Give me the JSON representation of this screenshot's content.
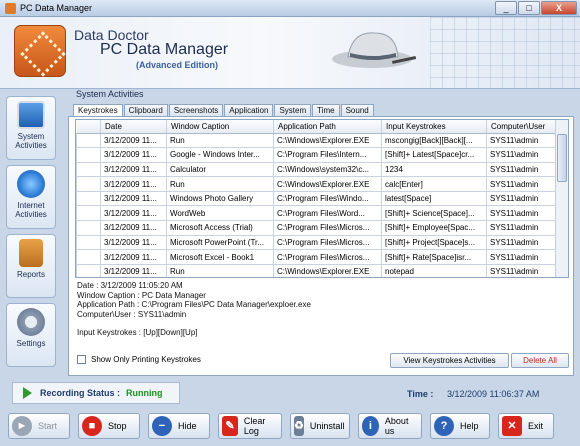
{
  "window": {
    "title": "PC Data Manager",
    "controls": [
      "_",
      "□",
      "X"
    ]
  },
  "header": {
    "line1": "Data Doctor",
    "line2": "PC Data Manager",
    "line3": "(Advanced Edition)"
  },
  "sidebar": {
    "items": [
      {
        "label": "System Activities",
        "icon": "monitor-icon"
      },
      {
        "label": "Internet Activities",
        "icon": "internet-explorer-icon"
      },
      {
        "label": "Reports",
        "icon": "clipboard-icon"
      },
      {
        "label": "Settings",
        "icon": "gear-icon"
      }
    ]
  },
  "main": {
    "section_title": "System Activities",
    "tabs": [
      "Keystrokes",
      "Clipboard",
      "Screenshots",
      "Application",
      "System",
      "Time",
      "Sound"
    ],
    "active_tab": "Keystrokes",
    "table": {
      "columns": [
        "Date",
        "Window Caption",
        "Application Path",
        "Input Keystrokes",
        "Computer\\User"
      ],
      "rows": [
        [
          "3/12/2009 11...",
          "Run",
          "C:\\Windows\\Explorer.EXE",
          "mscongig[Back][Back][...",
          "SYS11\\admin"
        ],
        [
          "3/12/2009 11...",
          "Google - Windows Inter...",
          "C:\\Program Files\\Intern...",
          "[Shift]+ Latest[Space]cr...",
          "SYS11\\admin"
        ],
        [
          "3/12/2009 11...",
          "Calculator",
          "C:\\Windows\\system32\\c...",
          "1234",
          "SYS11\\admin"
        ],
        [
          "3/12/2009 11...",
          "Run",
          "C:\\Windows\\Explorer.EXE",
          "calc[Enter]",
          "SYS11\\admin"
        ],
        [
          "3/12/2009 11...",
          "Windows Photo Gallery",
          "C:\\Program Files\\Windo...",
          "latest[Space]",
          "SYS11\\admin"
        ],
        [
          "3/12/2009 11...",
          "WordWeb",
          "C:\\Program Files\\Word...",
          "[Shift]+ Science[Space]...",
          "SYS11\\admin"
        ],
        [
          "3/12/2009 11...",
          "Microsoft Access (Trial)",
          "C:\\Program Files\\Micros...",
          "[Shift]+ Employee[Spac...",
          "SYS11\\admin"
        ],
        [
          "3/12/2009 11...",
          "Microsoft PowerPoint (Tr...",
          "C:\\Program Files\\Micros...",
          "[Shift]+ Project[Space]s...",
          "SYS11\\admin"
        ],
        [
          "3/12/2009 11...",
          "Microsoft Excel - Book1",
          "C:\\Program Files\\Micros...",
          "[Shift]+ Rate[Space]isr...",
          "SYS11\\admin"
        ],
        [
          "3/12/2009 11...",
          "Run",
          "C:\\Windows\\Explorer.EXE",
          "notepad",
          "SYS11\\admin"
        ]
      ]
    },
    "detail": {
      "date": "Date : 3/12/2009 11:05:20 AM",
      "caption": "Window Caption : PC Data Manager",
      "path": "Application Path : C:\\Program Files\\PC Data Manager\\exploer.exe",
      "user": "Computer\\User : SYS11\\admin",
      "keys": "Input Keystrokes : [Up][Down][Up]"
    },
    "filter_label": "Show Only Printing Keystrokes",
    "view_button": "View Keystrokes Activities",
    "delete_button": "Delete All"
  },
  "status": {
    "recording_label": "Recording Status :",
    "recording_value": "Running",
    "time_label": "Time :",
    "time_value": "3/12/2009 11:06:37 AM"
  },
  "toolbar": {
    "buttons": [
      {
        "label": "Start",
        "icon": "play-icon",
        "color": "#9aa6b5"
      },
      {
        "label": "Stop",
        "icon": "stop-icon",
        "color": "#d9261c"
      },
      {
        "label": "Hide",
        "icon": "minus-icon",
        "color": "#2f63b8"
      },
      {
        "label": "Clear Log",
        "icon": "eraser-icon",
        "color": "#d9261c"
      },
      {
        "label": "Uninstall",
        "icon": "recycle-bin-icon",
        "color": "#6d7f98"
      },
      {
        "label": "About us",
        "icon": "info-icon",
        "color": "#2f63b8"
      },
      {
        "label": "Help",
        "icon": "help-icon",
        "color": "#2f63b8"
      },
      {
        "label": "Exit",
        "icon": "close-icon",
        "color": "#d9261c"
      }
    ]
  }
}
